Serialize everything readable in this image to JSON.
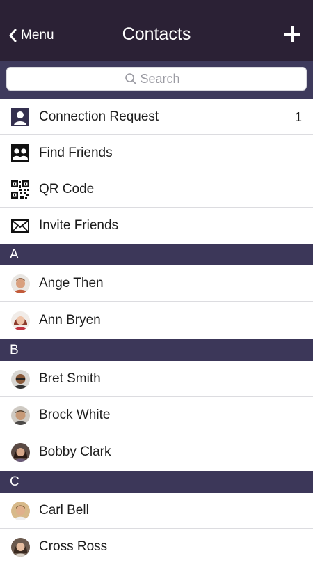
{
  "navbar": {
    "back_label": "Menu",
    "title": "Contacts",
    "add_icon": "plus-icon"
  },
  "search": {
    "placeholder": "Search",
    "value": ""
  },
  "actions": [
    {
      "label": "Connection Request",
      "icon": "person-icon",
      "badge": "1"
    },
    {
      "label": "Find Friends",
      "icon": "people-icon",
      "badge": ""
    },
    {
      "label": "QR Code",
      "icon": "qr-code-icon",
      "badge": ""
    },
    {
      "label": "Invite Friends",
      "icon": "envelope-icon",
      "badge": ""
    }
  ],
  "sections": [
    {
      "letter": "A",
      "contacts": [
        {
          "name": "Ange Then"
        },
        {
          "name": "Ann Bryen"
        }
      ]
    },
    {
      "letter": "B",
      "contacts": [
        {
          "name": "Bret Smith"
        },
        {
          "name": "Brock White"
        },
        {
          "name": "Bobby Clark"
        }
      ]
    },
    {
      "letter": "C",
      "contacts": [
        {
          "name": "Carl Bell"
        },
        {
          "name": "Cross Ross"
        }
      ]
    }
  ],
  "colors": {
    "navbar": "#2b2135",
    "section_header": "#3c3759",
    "search_bar_bg": "#3e3a5c"
  }
}
